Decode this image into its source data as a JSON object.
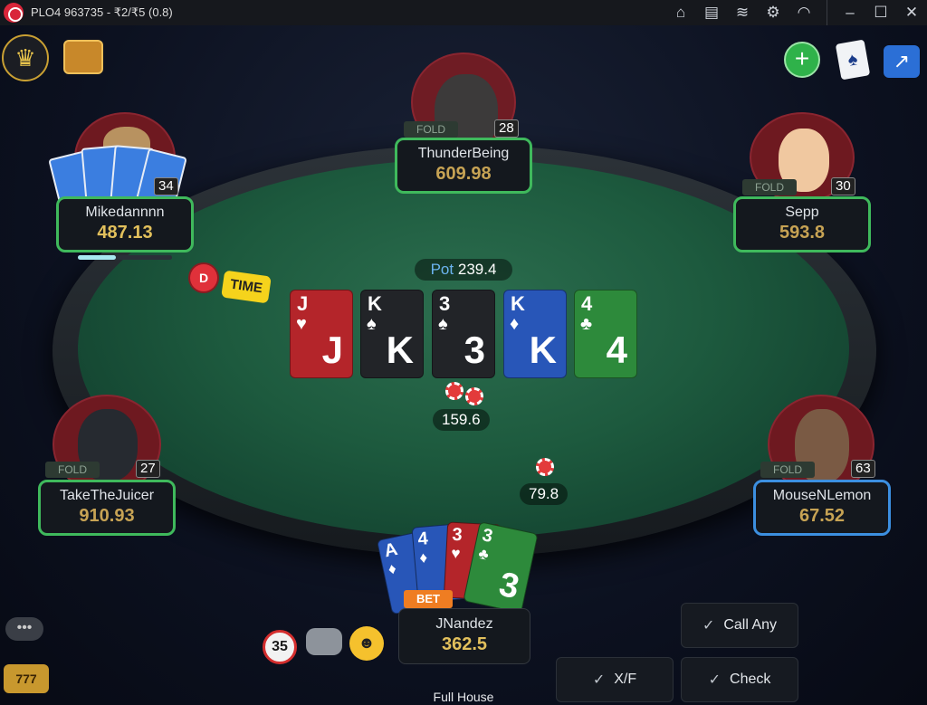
{
  "window": {
    "title": "PLO4 963735 - ₹2/₹5 (0.8)"
  },
  "titlebar_icons": [
    "home-icon",
    "clipboard-icon",
    "layers-icon",
    "gear-icon",
    "wifi-icon",
    "minimize-icon",
    "maximize-icon",
    "close-icon"
  ],
  "table": {
    "pot_label": "Pot",
    "pot_value": "239.4",
    "main_pot_chips": "159.6",
    "side_bet": "79.8",
    "time_label": "TIME",
    "dealer_label": "D"
  },
  "board": [
    {
      "rank": "J",
      "suit": "♥",
      "color": "red"
    },
    {
      "rank": "K",
      "suit": "♠",
      "color": "black"
    },
    {
      "rank": "3",
      "suit": "♠",
      "color": "black"
    },
    {
      "rank": "K",
      "suit": "♦",
      "color": "bluec"
    },
    {
      "rank": "4",
      "suit": "♣",
      "color": "green"
    }
  ],
  "players": {
    "top": {
      "name": "ThunderBeing",
      "stack": "609.98",
      "badge": "28",
      "status": "FOLD"
    },
    "topleft": {
      "name": "Mikedannnn",
      "stack": "487.13",
      "badge": "34"
    },
    "topright": {
      "name": "Sepp",
      "stack": "593.8",
      "badge": "30",
      "status": "FOLD"
    },
    "left": {
      "name": "TakeTheJuicer",
      "stack": "910.93",
      "badge": "27",
      "status": "FOLD"
    },
    "right": {
      "name": "MouseNLemon",
      "stack": "67.52",
      "badge": "63",
      "status": "FOLD"
    }
  },
  "hero": {
    "name": "JNandez",
    "stack": "362.5",
    "bet_label": "BET",
    "hand_name": "Full House",
    "cards": [
      {
        "rank": "A",
        "suit": "♦",
        "color": "bluec"
      },
      {
        "rank": "4",
        "suit": "♦",
        "color": "bluec"
      },
      {
        "rank": "3",
        "suit": "♥",
        "color": "red"
      },
      {
        "rank": "3",
        "suit": "♣",
        "color": "green"
      }
    ]
  },
  "actions": {
    "call_any": "Call Any",
    "xf": "X/F",
    "check": "Check"
  },
  "bottom_left": {
    "timer": "35"
  }
}
